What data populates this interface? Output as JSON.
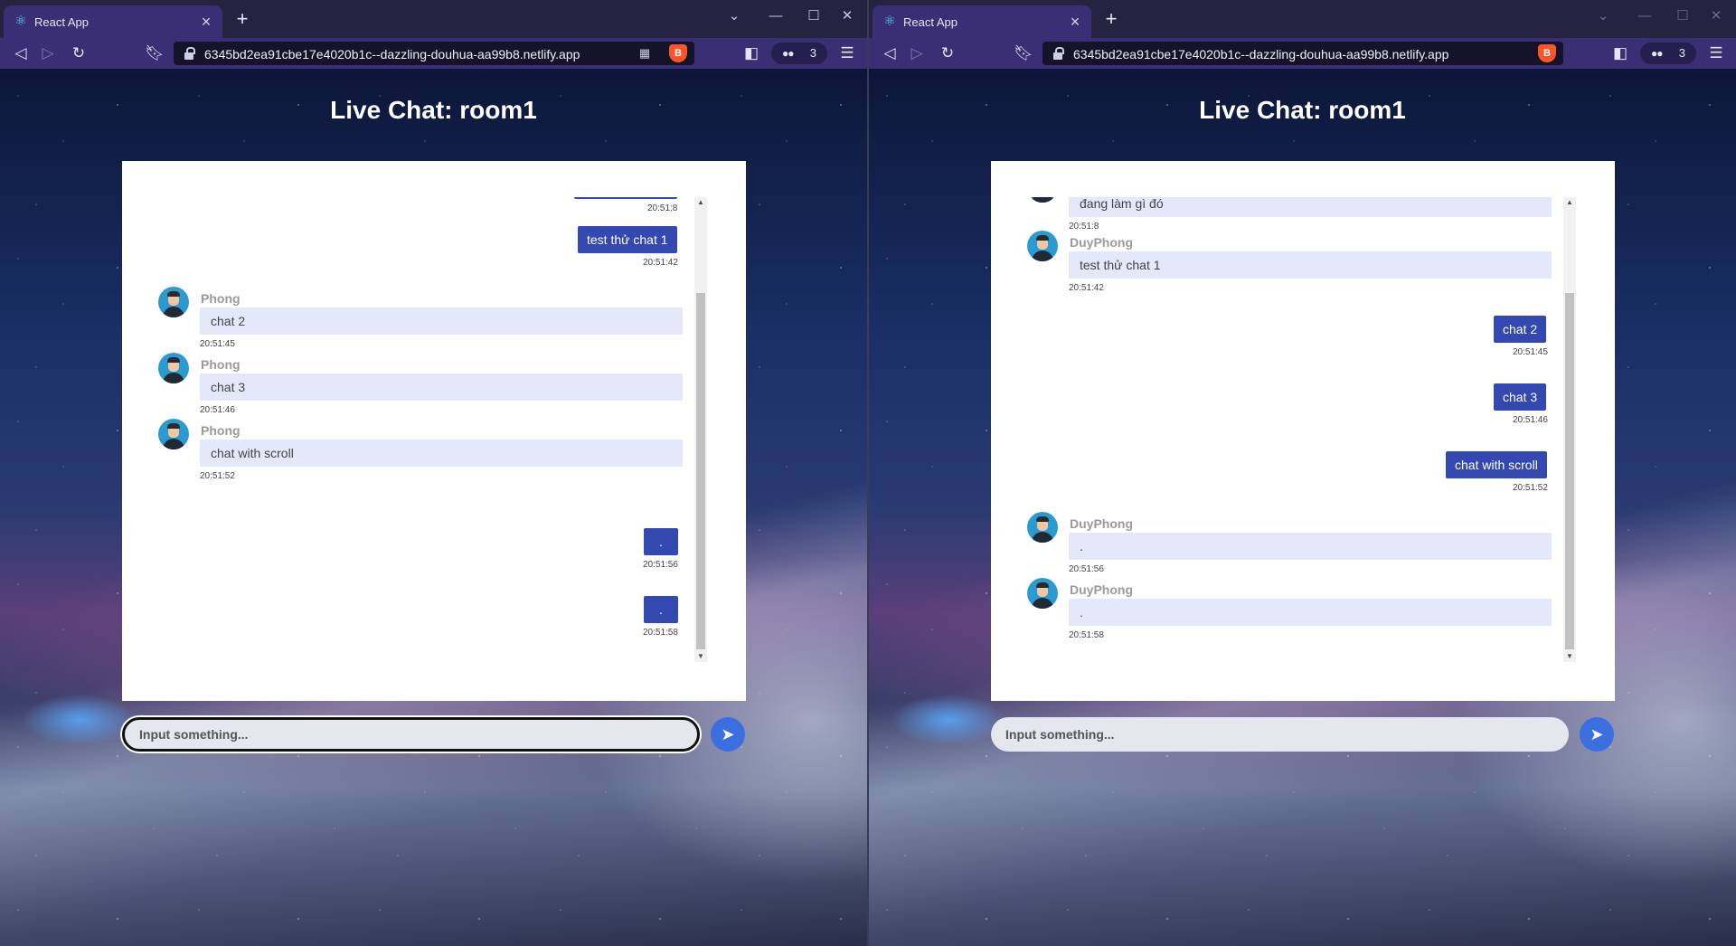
{
  "left_window": {
    "tab_title": "React App",
    "url": "6345bd2ea91cbe17e4020b1c--dazzling-douhua-aa99b8.netlify.app",
    "vpn_count": "3",
    "page_title": "Live Chat: room1",
    "input_placeholder": "Input something...",
    "messages": [
      {
        "type": "own",
        "text": "",
        "time": "20:51:8"
      },
      {
        "type": "own",
        "text": "test thử chat 1",
        "time": "20:51:42"
      },
      {
        "type": "other",
        "sender": "Phong",
        "text": "chat 2",
        "time": "20:51:45"
      },
      {
        "type": "other",
        "sender": "Phong",
        "text": "chat 3",
        "time": "20:51:46"
      },
      {
        "type": "other",
        "sender": "Phong",
        "text": "chat with scroll",
        "time": "20:51:52"
      },
      {
        "type": "own",
        "text": ".",
        "time": "20:51:56"
      },
      {
        "type": "own",
        "text": ".",
        "time": "20:51:58"
      }
    ]
  },
  "right_window": {
    "tab_title": "React App",
    "url": "6345bd2ea91cbe17e4020b1c--dazzling-douhua-aa99b8.netlify.app",
    "vpn_count": "3",
    "page_title": "Live Chat: room1",
    "input_placeholder": "Input something...",
    "messages": [
      {
        "type": "other",
        "sender": "",
        "text": "đang làm gì đó",
        "time": "20:51:8"
      },
      {
        "type": "other",
        "sender": "DuyPhong",
        "text": "test thử chat 1",
        "time": "20:51:42"
      },
      {
        "type": "own",
        "text": "chat 2",
        "time": "20:51:45"
      },
      {
        "type": "own",
        "text": "chat 3",
        "time": "20:51:46"
      },
      {
        "type": "own",
        "text": "chat with scroll",
        "time": "20:51:52"
      },
      {
        "type": "other",
        "sender": "DuyPhong",
        "text": ".",
        "time": "20:51:56"
      },
      {
        "type": "other",
        "sender": "DuyPhong",
        "text": ".",
        "time": "20:51:58"
      }
    ]
  },
  "colors": {
    "own_bubble": "#3349b1",
    "other_bubble": "#e5e8fb",
    "send_button": "#3b6fe0",
    "tab_active": "#3a2f74"
  },
  "icons": {
    "back": "back-icon",
    "forward": "forward-icon",
    "reload": "reload-icon",
    "bookmark": "bookmark-icon",
    "lock": "lock-icon",
    "brave": "brave-shield-icon",
    "sidebar": "sidebar-icon",
    "menu": "menu-icon",
    "send": "send-icon"
  }
}
